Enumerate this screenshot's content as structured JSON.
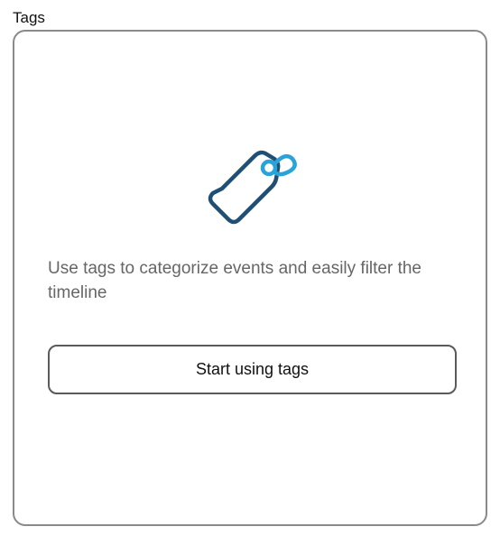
{
  "section": {
    "label": "Tags"
  },
  "empty_state": {
    "icon": "tag-icon",
    "message": "Use tags to categorize events and easily filter the timeline",
    "button_label": "Start using tags"
  },
  "colors": {
    "tag_body": "#1f4f75",
    "tag_ring": "#2aa3d8",
    "panel_border": "#8a8a8a",
    "text_muted": "#666666"
  }
}
